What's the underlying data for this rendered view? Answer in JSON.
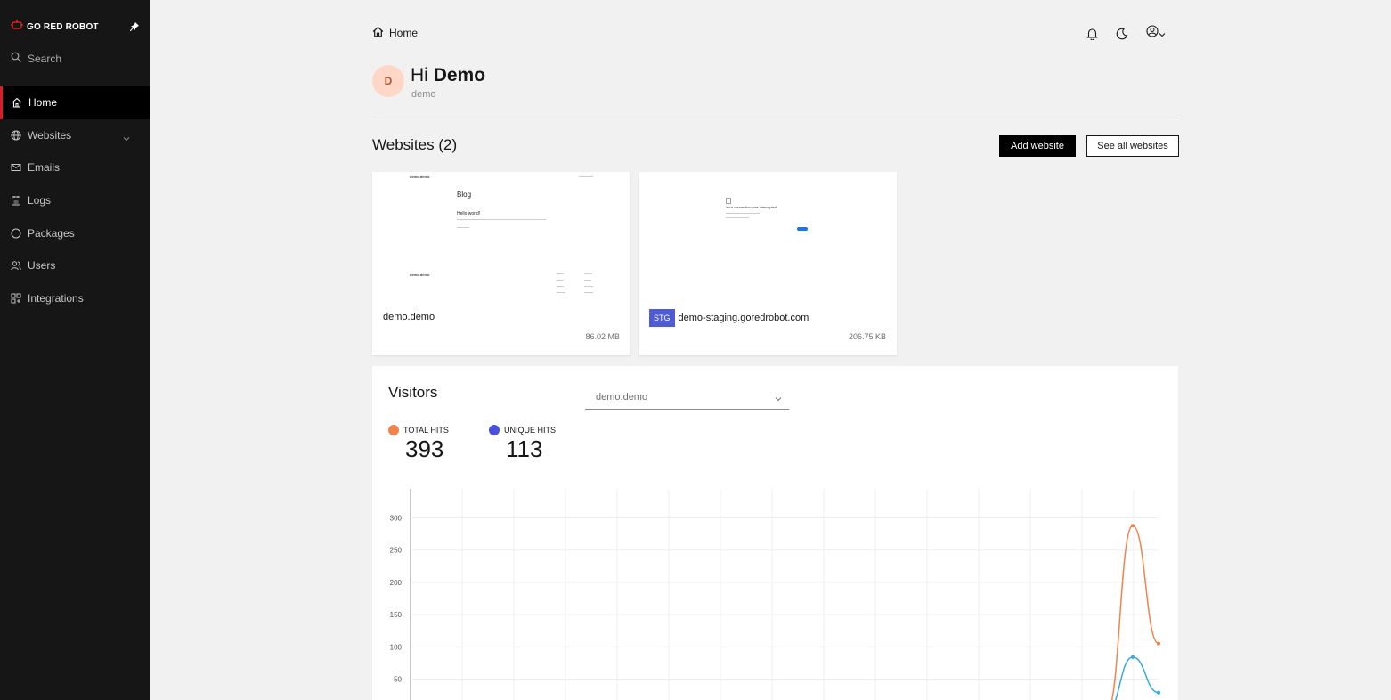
{
  "sidebar": {
    "brand": "GO RED ROBOT",
    "search_placeholder": "Search",
    "items": [
      {
        "label": "Home",
        "icon": "home-icon",
        "active": true
      },
      {
        "label": "Websites",
        "icon": "globe-icon",
        "expandable": true
      },
      {
        "label": "Emails",
        "icon": "mail-icon"
      },
      {
        "label": "Logs",
        "icon": "log-icon"
      },
      {
        "label": "Packages",
        "icon": "package-icon"
      },
      {
        "label": "Users",
        "icon": "users-icon"
      },
      {
        "label": "Integrations",
        "icon": "integrations-icon"
      }
    ]
  },
  "header": {
    "breadcrumb": "Home",
    "icons": [
      "bell-icon",
      "moon-icon",
      "user-avatar-icon"
    ]
  },
  "greeting": {
    "avatar_initial": "D",
    "hi": "Hi",
    "name": "Demo",
    "username": "demo"
  },
  "websites": {
    "title": "Websites (2)",
    "add_label": "Add website",
    "see_all_label": "See all websites",
    "cards": [
      {
        "name": "demo.demo",
        "size": "86.02 MB",
        "thumbnail": {
          "site": "demo.demo",
          "heading": "Blog",
          "post_title": "Hello world!",
          "footer_site": "demo.demo"
        }
      },
      {
        "badge": "STG",
        "name": "demo-staging.goredrobot.com",
        "size": "206.75 KB",
        "thumbnail": {
          "heading": "Your connection was interrupted"
        }
      }
    ]
  },
  "visitors": {
    "title": "Visitors",
    "selected_site": "demo.demo",
    "metrics": [
      {
        "label": "TOTAL HITS",
        "value": "393",
        "color": "#f0834a"
      },
      {
        "label": "UNIQUE HITS",
        "value": "113",
        "color": "#4a4fe0"
      }
    ]
  },
  "chart_data": {
    "type": "line",
    "y_ticks": [
      50,
      100,
      150,
      200,
      250,
      300
    ],
    "ylim": [
      0,
      345
    ],
    "x_points": 15,
    "series": [
      {
        "color": "#f0834a",
        "values": [
          0,
          0,
          0,
          0,
          0,
          0,
          0,
          0,
          0,
          0,
          0,
          0,
          0,
          0,
          0,
          0,
          0,
          0,
          0,
          0,
          0,
          0,
          0,
          0,
          0,
          0,
          0,
          0,
          0,
          0,
          0,
          0,
          0,
          0,
          0,
          0,
          0,
          0,
          0,
          0,
          0,
          0,
          0,
          0,
          0,
          0,
          0,
          0,
          0,
          0,
          0,
          0,
          0,
          0,
          0,
          0,
          0,
          288,
          105
        ]
      },
      {
        "color": "#3ba8d8",
        "values": [
          0,
          0,
          0,
          0,
          0,
          0,
          0,
          0,
          0,
          0,
          0,
          0,
          0,
          0,
          0,
          0,
          0,
          0,
          0,
          0,
          0,
          0,
          0,
          0,
          0,
          0,
          0,
          0,
          0,
          0,
          0,
          0,
          0,
          0,
          0,
          0,
          0,
          0,
          0,
          0,
          0,
          0,
          0,
          0,
          0,
          0,
          0,
          0,
          0,
          0,
          0,
          0,
          0,
          0,
          0,
          0,
          0,
          84,
          29
        ]
      }
    ]
  }
}
